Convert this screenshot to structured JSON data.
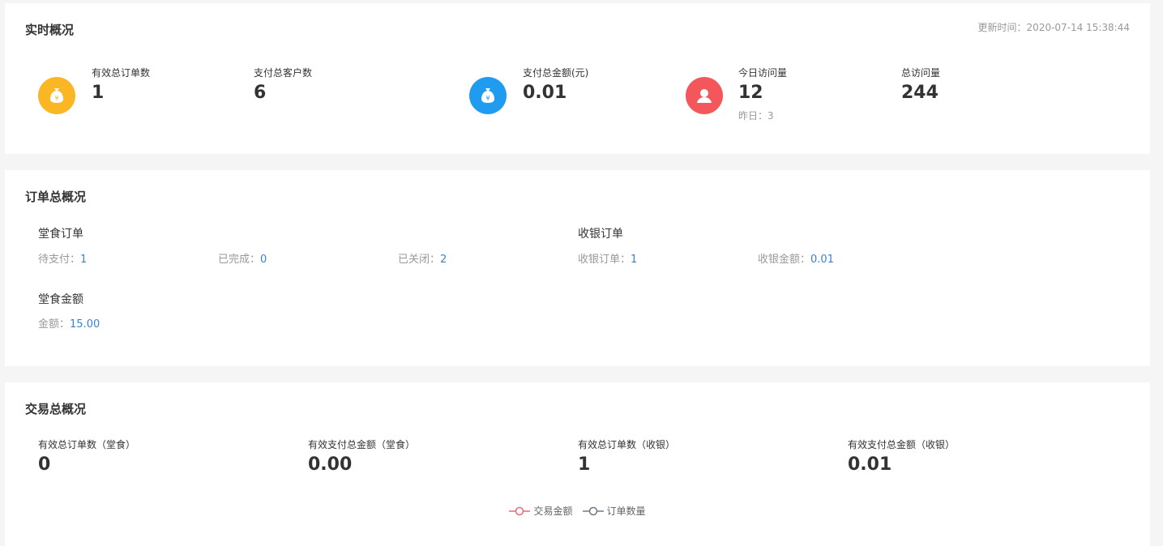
{
  "realtime": {
    "title": "实时概况",
    "updated_label": "更新时间：",
    "updated_time": "2020-07-14 15:38:44",
    "stats": [
      {
        "label": "有效总订单数",
        "value": "1",
        "icon": "money-bag-icon",
        "color": "#fbb624"
      },
      {
        "label": "支付总客户数",
        "value": "6"
      },
      {
        "label": "支付总金额(元)",
        "value": "0.01",
        "icon": "money-bag-icon",
        "color": "#1f9bf0"
      },
      {
        "label": "今日访问量",
        "value": "12",
        "icon": "user-icon",
        "color": "#f3575b",
        "sub_label": "昨日：",
        "sub_value": "3"
      },
      {
        "label": "总访问量",
        "value": "244"
      }
    ]
  },
  "orders": {
    "title": "订单总概况",
    "dine_in": {
      "title": "堂食订单",
      "items": [
        {
          "label": "待支付：",
          "value": "1"
        },
        {
          "label": "已完成：",
          "value": "0"
        },
        {
          "label": "已关闭：",
          "value": "2"
        }
      ]
    },
    "cashier": {
      "title": "收银订单",
      "items": [
        {
          "label": "收银订单：",
          "value": "1"
        },
        {
          "label": "收银金额：",
          "value": "0.01"
        }
      ]
    },
    "dine_amount": {
      "title": "堂食金额",
      "items": [
        {
          "label": "金额：",
          "value": "15.00"
        }
      ]
    }
  },
  "transactions": {
    "title": "交易总概况",
    "stats": [
      {
        "label": "有效总订单数（堂食）",
        "value": "0"
      },
      {
        "label": "有效支付总金额（堂食）",
        "value": "0.00"
      },
      {
        "label": "有效总订单数（收银）",
        "value": "1"
      },
      {
        "label": "有效支付总金额（收银）",
        "value": "0.01"
      }
    ],
    "legend": [
      {
        "name": "交易金额",
        "color": "#e06c75"
      },
      {
        "name": "订单数量",
        "color": "#6e7b85"
      }
    ]
  }
}
